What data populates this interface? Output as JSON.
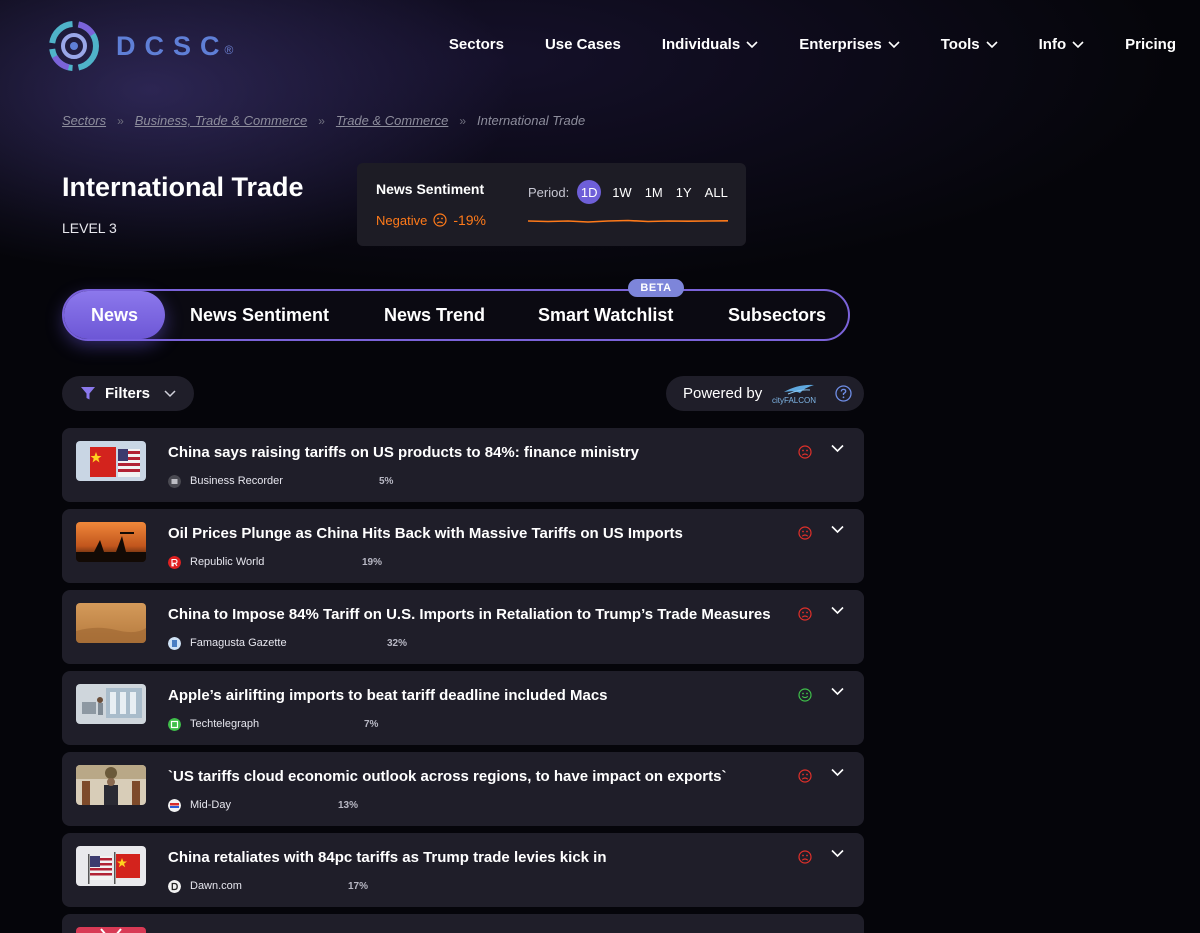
{
  "brand": {
    "name": "DCSC",
    "reg_mark": "®",
    "colors": {
      "accent": "#7b63d9",
      "negative": "#ff7a1a",
      "positive": "#3fbf4a",
      "bearish_icon": "#e0302a"
    }
  },
  "nav": {
    "items": [
      {
        "label": "Sectors",
        "dropdown": false
      },
      {
        "label": "Use Cases",
        "dropdown": false
      },
      {
        "label": "Individuals",
        "dropdown": true
      },
      {
        "label": "Enterprises",
        "dropdown": true
      },
      {
        "label": "Tools",
        "dropdown": true
      },
      {
        "label": "Info",
        "dropdown": true
      },
      {
        "label": "Pricing",
        "dropdown": false
      }
    ]
  },
  "breadcrumb": {
    "items": [
      "Sectors",
      "Business, Trade & Commerce",
      "Trade & Commerce"
    ],
    "separator": "»",
    "current": "International Trade"
  },
  "page": {
    "title": "International Trade",
    "level": "LEVEL 3"
  },
  "sentiment_card": {
    "title": "News Sentiment",
    "label": "Negative",
    "value": "-19%",
    "period_label": "Period:",
    "periods": [
      "1D",
      "1W",
      "1M",
      "1Y",
      "ALL"
    ],
    "active_period": "1D",
    "sparkline_color": "#ff7a1a"
  },
  "tabs": {
    "items": [
      "News",
      "News Sentiment",
      "News Trend",
      "Smart Watchlist",
      "Subsectors"
    ],
    "active": "News",
    "beta_label": "BETA"
  },
  "toolbar": {
    "filters_label": "Filters",
    "powered_label": "Powered by",
    "powered_logo": "cityFALCON"
  },
  "news": [
    {
      "title": "China says raising tariffs on US products to 84%: finance ministry",
      "source": "Business Recorder",
      "pct": "5%",
      "sentiment": "negative",
      "icon": "sad-face-icon"
    },
    {
      "title": "Oil Prices Plunge as China Hits Back with Massive Tariffs on US Imports",
      "source": "Republic World",
      "pct": "19%",
      "sentiment": "negative",
      "icon": "sad-face-icon"
    },
    {
      "title": "China to Impose 84% Tariff on U.S. Imports in Retaliation to Trump’s Trade Measures",
      "source": "Famagusta Gazette",
      "pct": "32%",
      "sentiment": "negative",
      "icon": "sad-face-icon"
    },
    {
      "title": "Apple’s airlifting imports to beat tariff deadline included Macs",
      "source": "Techtelegraph",
      "pct": "7%",
      "sentiment": "positive",
      "icon": "happy-face-icon"
    },
    {
      "title": "`US tariffs cloud economic outlook across regions, to have impact on exports`",
      "source": "Mid-Day",
      "pct": "13%",
      "sentiment": "negative",
      "icon": "sad-face-icon"
    },
    {
      "title": "China retaliates with 84pc tariffs as Trump trade levies kick in",
      "source": "Dawn.com",
      "pct": "17%",
      "sentiment": "negative",
      "icon": "sad-face-icon"
    }
  ]
}
